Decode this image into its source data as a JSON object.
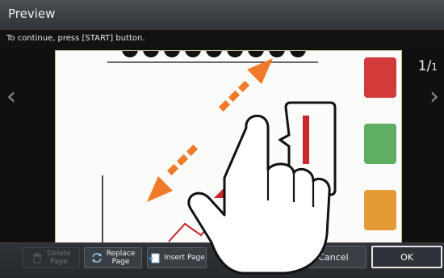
{
  "window": {
    "title": "Preview"
  },
  "message": "To continue, press [START] button.",
  "page_counter": {
    "current": "1",
    "total": "1"
  },
  "buttons": {
    "delete_page": "Delete\nPage",
    "replace_page": "Replace\nPage",
    "insert_page": "Insert Page",
    "cancel": "Cancel",
    "ok": "OK"
  },
  "icons": {
    "prev": "chevron-left-icon",
    "next": "chevron-right-icon",
    "delete": "trash-icon",
    "replace": "replace-icon",
    "insert": "insert-page-icon",
    "gesture": "pinch-hand-icon"
  },
  "colors": {
    "red": "#d43a3a",
    "green": "#5fae61",
    "orange": "#e49a35",
    "arrow": "#f07a2a"
  }
}
